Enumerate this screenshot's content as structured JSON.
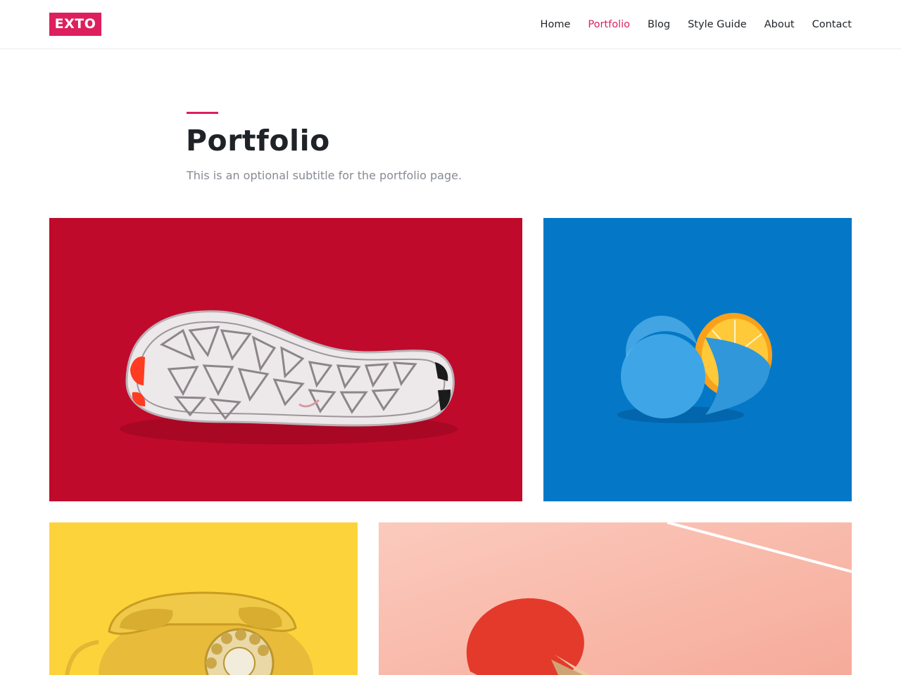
{
  "header": {
    "logo_text": "EXTO",
    "nav": [
      {
        "label": "Home",
        "active": false
      },
      {
        "label": "Portfolio",
        "active": true
      },
      {
        "label": "Blog",
        "active": false
      },
      {
        "label": "Style Guide",
        "active": false
      },
      {
        "label": "About",
        "active": false
      },
      {
        "label": "Contact",
        "active": false
      }
    ]
  },
  "hero": {
    "title": "Portfolio",
    "subtitle": "This is an optional subtitle for the portfolio page."
  },
  "colors": {
    "accent": "#dd1f5e",
    "text": "#1f2328",
    "muted": "#868b93",
    "tile_red": "#c00a2b",
    "tile_blue": "#0478c7",
    "tile_yellow": "#fdd33c",
    "tile_pink": "#f9bfb0"
  },
  "portfolio": {
    "items": [
      {
        "image": "sneaker-sole-image"
      },
      {
        "image": "blue-orange-image"
      },
      {
        "image": "yellow-rotary-phone-image"
      },
      {
        "image": "ping-pong-paddle-image"
      }
    ]
  }
}
